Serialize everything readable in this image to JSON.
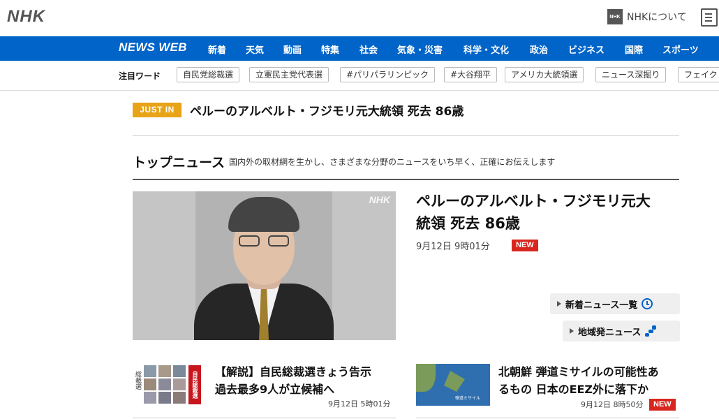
{
  "header": {
    "logo": "NHK",
    "about_icon": "NHK",
    "about_label": "NHKについて"
  },
  "nav": {
    "brand": "NEWS WEB",
    "items": [
      "新着",
      "天気",
      "動画",
      "特集",
      "社会",
      "気象・災害",
      "科学・文化",
      "政治",
      "ビジネス",
      "国際",
      "スポーツ"
    ]
  },
  "keywords": {
    "label": "注目ワード",
    "tags": [
      "自民党総裁選",
      "立憲民主党代表選",
      "#パリパラリンピック",
      "#大谷翔平",
      "アメリカ大統領選",
      "ニュース深掘り",
      "フェイク"
    ]
  },
  "just_in": {
    "badge": "JUST IN",
    "headline": "ペルーのアルベルト・フジモリ元大統領 死去 86歳"
  },
  "top_news": {
    "title": "トップニュース",
    "description": "国内外の取材網を生かし、さまざまな分野のニュースをいち早く、正確にお伝えします",
    "main": {
      "watermark": "NHK",
      "headline_line1": "ペルーのアルベルト・フジモリ元大",
      "headline_line2": "統領 死去 86歳",
      "time": "9月12日 9時01分",
      "badge": "NEW"
    },
    "links": {
      "latest": "新着ニュース一覧",
      "regional": "地域発ニュース"
    },
    "articles": [
      {
        "thumb_side": "総裁選",
        "thumb_tag": "自民総裁選",
        "title_line1": "【解説】自民総裁選きょう告示",
        "title_line2": "過去最多9人が立候補へ",
        "time": "9月12日 5時01分"
      },
      {
        "thumb_label": "弾道ミサイル",
        "title_line1": "北朝鮮 弾道ミサイルの可能性あ",
        "title_line2": "るもの 日本のEEZ外に落下か",
        "time": "9月12日 8時50分",
        "badge": "NEW"
      }
    ]
  },
  "colors": {
    "nav_blue": "#0064c8",
    "just_in_orange": "#e8a316",
    "new_red": "#d8261f"
  }
}
